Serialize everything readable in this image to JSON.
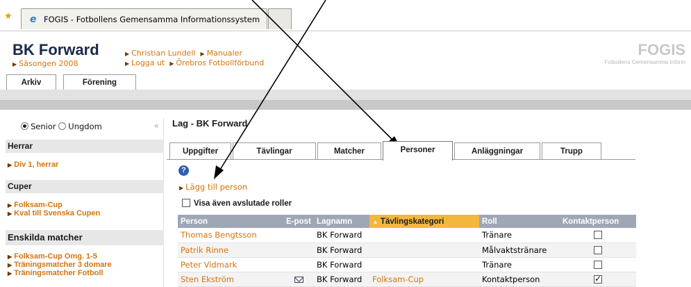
{
  "browser": {
    "tab_title": "FOGIS - Fotbollens Gemensamma Informationssystem"
  },
  "header": {
    "club_name": "BK Forward",
    "season": "Säsongen 2008",
    "links": [
      "Christian Lundell",
      "Manualer",
      "Logga ut",
      "Örebros Fotbollförbund"
    ],
    "logo": "FOGIS",
    "logo_sub": "Fotbollens Gemensamma Inform",
    "menu": [
      "Arkiv",
      "Förening"
    ]
  },
  "sidebar": {
    "radio_senior": "Senior",
    "radio_ungdom": "Ungdom",
    "sections": [
      {
        "title": "Herrar",
        "links": [
          "Div 1, herrar"
        ]
      },
      {
        "title": "Cuper",
        "links": [
          "Folksam-Cup",
          "Kval till Svenska Cupen"
        ]
      },
      {
        "title": "Enskilda matcher",
        "links": [
          "Folksam-Cup Omg. 1-5",
          "Träningsmatcher 3 domare",
          "Träningsmatcher Fotboll"
        ]
      }
    ]
  },
  "main": {
    "title": "Lag - BK Forward",
    "tabs": [
      "Uppgifter",
      "Tävlingar",
      "Matcher",
      "Personer",
      "Anläggningar",
      "Trupp"
    ],
    "active_tab": "Personer",
    "help_icon": "?",
    "add_person": "Lägg till person",
    "show_roles": "Visa även avslutade roller",
    "columns": [
      "Person",
      "E-post",
      "Lagnamn",
      "Tävlingskategori",
      "Roll",
      "Kontaktperson"
    ],
    "sort_indicator": "▲",
    "rows": [
      {
        "person": "Thomas Bengtsson",
        "email": false,
        "team": "BK Forward",
        "category": "",
        "role": "Tränare",
        "contact": false
      },
      {
        "person": "Patrik Rinne",
        "email": false,
        "team": "BK Forward",
        "category": "",
        "role": "Målvaktstränare",
        "contact": false
      },
      {
        "person": "Peter Vidmark",
        "email": false,
        "team": "BK Forward",
        "category": "",
        "role": "Tränare",
        "contact": false
      },
      {
        "person": "Sten Ekström",
        "email": true,
        "team": "BK Forward",
        "category": "Folksam-Cup",
        "role": "Kontaktperson",
        "contact": true
      }
    ]
  },
  "colors": {
    "link": "#d4740c",
    "header_bg": "#9fa7b6",
    "sorted_bg": "#f2b83e"
  }
}
